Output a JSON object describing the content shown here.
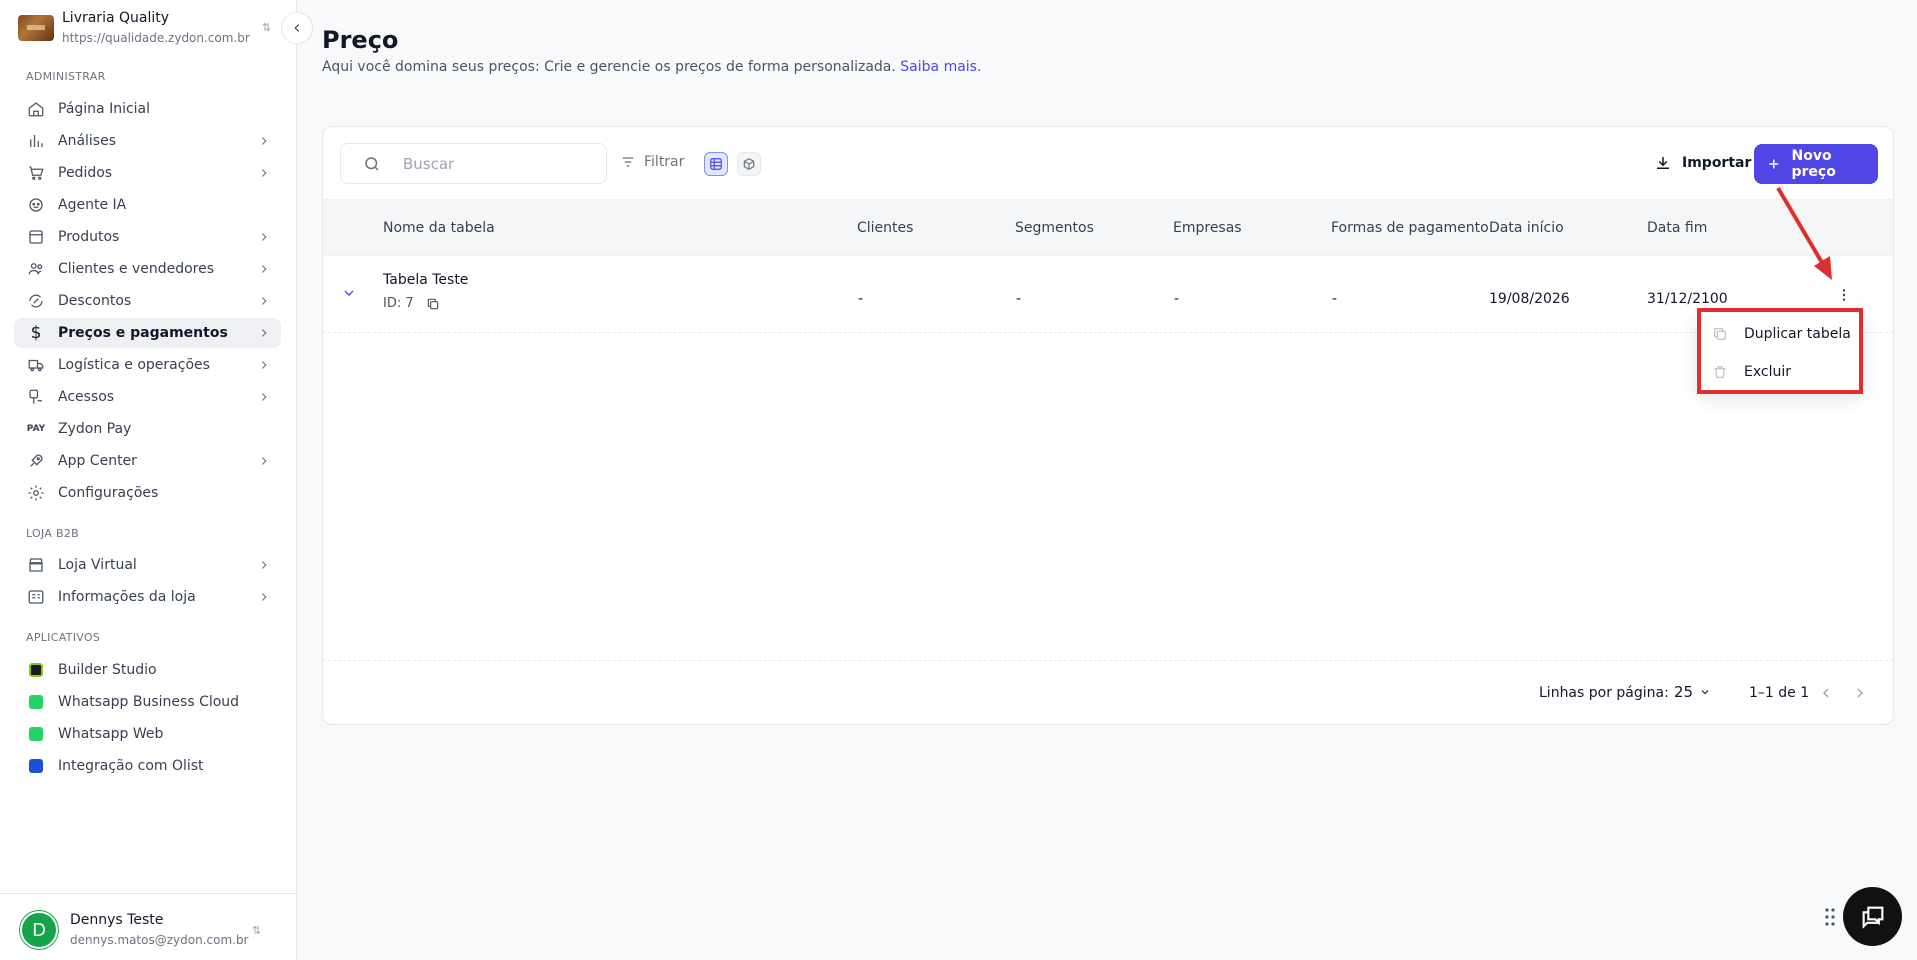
{
  "store": {
    "name": "Livraria Quality",
    "url": "https://qualidade.zydon.com.br"
  },
  "sidebar": {
    "sections": {
      "admin": "ADMINISTRAR",
      "loja": "LOJA B2B",
      "apps": "APLICATIVOS"
    },
    "items": [
      {
        "label": "Página Inicial",
        "icon": "home-icon"
      },
      {
        "label": "Análises",
        "icon": "chart-icon"
      },
      {
        "label": "Pedidos",
        "icon": "cart-icon"
      },
      {
        "label": "Agente IA",
        "icon": "bot-icon"
      },
      {
        "label": "Produtos",
        "icon": "box-icon"
      },
      {
        "label": "Clientes e vendedores",
        "icon": "users-icon"
      },
      {
        "label": "Descontos",
        "icon": "percent-icon"
      },
      {
        "label": "Preços e pagamentos",
        "icon": "dollar-icon",
        "active": true
      },
      {
        "label": "Logística e operações",
        "icon": "truck-icon"
      },
      {
        "label": "Acessos",
        "icon": "access-icon"
      },
      {
        "label": "Zydon Pay",
        "icon": "pay-icon",
        "icon_text": "PAY"
      },
      {
        "label": "App Center",
        "icon": "rocket-icon"
      },
      {
        "label": "Configurações",
        "icon": "gear-icon"
      }
    ],
    "store_items": [
      {
        "label": "Loja Virtual",
        "icon": "store-icon"
      },
      {
        "label": "Informações da loja",
        "icon": "info-icon"
      }
    ],
    "apps": [
      {
        "label": "Builder Studio",
        "icon": "builder-studio-icon",
        "color": "#1a1a1a"
      },
      {
        "label": "Whatsapp Business Cloud",
        "icon": "whatsapp-icon",
        "color": "#25d366"
      },
      {
        "label": "Whatsapp Web",
        "icon": "whatsapp-icon",
        "color": "#25d366"
      },
      {
        "label": "Integração com Olist",
        "icon": "olist-icon",
        "color": "#1d4ed8"
      }
    ]
  },
  "user": {
    "initial": "D",
    "name": "Dennys Teste",
    "email": "dennys.matos@zydon.com.br"
  },
  "page": {
    "title": "Preço",
    "subtitle": "Aqui você domina seus preços: Crie e gerencie os preços de forma personalizada.",
    "learn_more": "Saiba mais."
  },
  "toolbar": {
    "search_placeholder": "Buscar",
    "filter_label": "Filtrar",
    "import_label": "Importar",
    "new_label": "Novo preço"
  },
  "table": {
    "columns": [
      "Nome da tabela",
      "Clientes",
      "Segmentos",
      "Empresas",
      "Formas de pagamento",
      "Data início",
      "Data fim"
    ],
    "rows": [
      {
        "name": "Tabela Teste",
        "id": "ID: 7",
        "clientes": "-",
        "segmentos": "-",
        "empresas": "-",
        "formas": "-",
        "inicio": "19/08/2026",
        "fim": "31/12/2100"
      }
    ]
  },
  "pagination": {
    "rows_label": "Linhas por página:",
    "rows_value": "25",
    "range": "1–1 de 1"
  },
  "menu": {
    "duplicate": "Duplicar tabela",
    "delete": "Excluir"
  },
  "colors": {
    "primary": "#4f46e5",
    "highlight": "#e02d2d",
    "active_bg": "#eff0f3"
  }
}
